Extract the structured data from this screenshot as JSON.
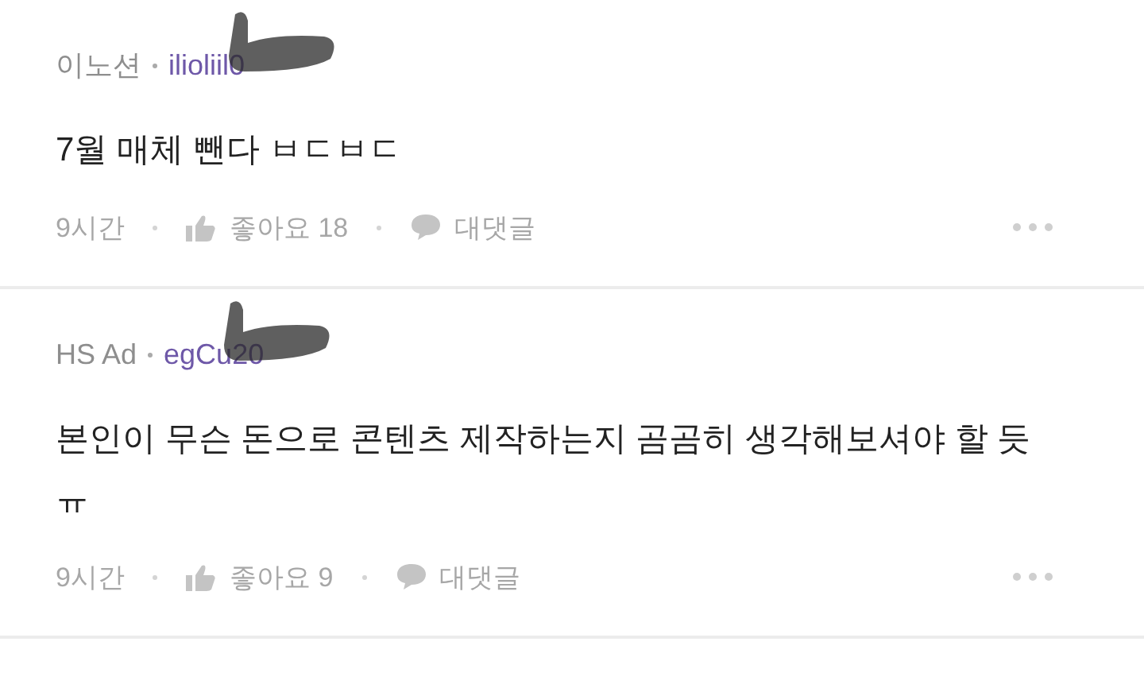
{
  "comments": [
    {
      "author": "이노션",
      "user_id": "ilioliil0",
      "text": "7월 매체 뺀다 ㅂㄷㅂㄷ",
      "time": "9시간",
      "likes": "좋아요 18",
      "reply": "대댓글"
    },
    {
      "author": "HS Ad",
      "user_id": "egCu20",
      "text": "본인이 무슨 돈으로 콘텐츠 제작하는지 곰곰히 생각해보셔야 할 듯 ㅠ",
      "time": "9시간",
      "likes": "좋아요 9",
      "reply": "대댓글"
    }
  ]
}
